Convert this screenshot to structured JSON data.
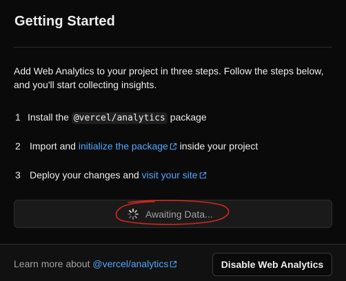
{
  "card": {
    "title": "Getting Started",
    "intro": "Add Web Analytics to your project in three steps. Follow the steps below, and you'll start collecting insights."
  },
  "steps": [
    {
      "number": "1",
      "text_before": "Install the ",
      "code": "@vercel/analytics",
      "text_after": " package"
    },
    {
      "number": "2",
      "text_before": "Import and ",
      "link": "initialize the package",
      "text_after": " inside your project"
    },
    {
      "number": "3",
      "text_before": "Deploy your changes and ",
      "link": "visit your site",
      "text_after": ""
    }
  ],
  "status": {
    "label": "Awaiting Data...",
    "icon": "spinner-icon"
  },
  "footer": {
    "learn_more_prefix": "Learn more about ",
    "learn_more_link": "@vercel/analytics",
    "disable_button": "Disable Web Analytics"
  },
  "colors": {
    "background": "#0a0a0a",
    "link": "#52a8ff",
    "annotation": "#d7261e",
    "muted_text": "#a1a1a1"
  }
}
